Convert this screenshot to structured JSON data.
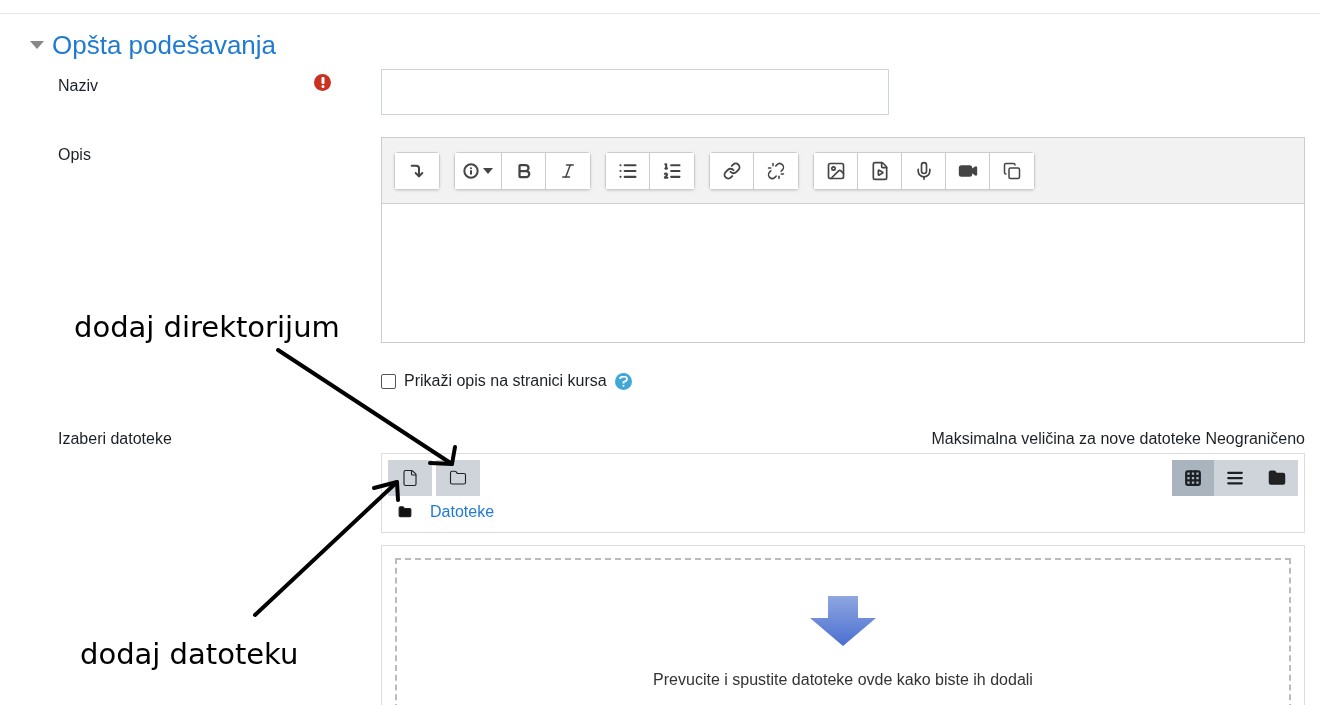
{
  "section": {
    "title": "Opšta podešavanja",
    "expanded": true
  },
  "name_field": {
    "label": "Naziv",
    "required": true
  },
  "description_field": {
    "label": "Opis"
  },
  "show_description": {
    "label": "Prikaži opis na stranici kursa",
    "checked": false
  },
  "files": {
    "label": "Izaberi datoteke",
    "max_size": "Maksimalna veličina za nove datoteke Neograničeno",
    "path": "Datoteke",
    "views": [
      {
        "kind": "grid",
        "selected": true
      },
      {
        "kind": "list",
        "selected": false
      },
      {
        "kind": "tree",
        "selected": false
      }
    ],
    "drop_hint": "Prevucite i spustite datoteke ovde kako biste ih dodali"
  },
  "annotations": [
    {
      "kind": "folder",
      "text": "dodaj direktorijum"
    },
    {
      "kind": "file",
      "text": "dodaj datoteku"
    }
  ]
}
